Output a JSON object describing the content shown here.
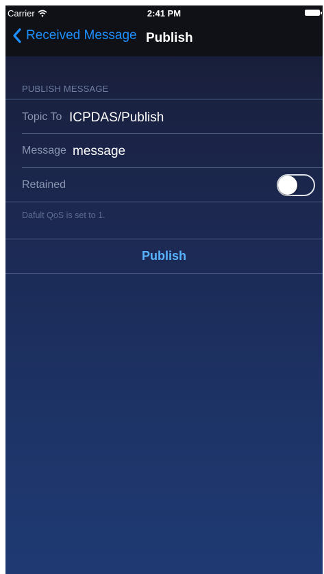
{
  "status_bar": {
    "carrier": "Carrier",
    "time": "2:41 PM"
  },
  "nav": {
    "back_label": "Received Message",
    "title": "Publish"
  },
  "publish_section": {
    "header": "PUBLISH MESSAGE",
    "topic": {
      "label": "Topic To",
      "value": "ICPDAS/Publish"
    },
    "message": {
      "label": "Message",
      "value": "message"
    },
    "retained": {
      "label": "Retained",
      "on": false
    },
    "note": "Dafult QoS is set to 1."
  },
  "actions": {
    "publish_label": "Publish"
  },
  "colors": {
    "accent_blue": "#1e8fff",
    "button_blue": "#5ab3ff",
    "background_top": "#151a2e",
    "background_bottom": "#1f3a73"
  },
  "icons": {
    "back": "chevron-left-icon",
    "wifi": "wifi-icon",
    "battery": "battery-icon"
  }
}
